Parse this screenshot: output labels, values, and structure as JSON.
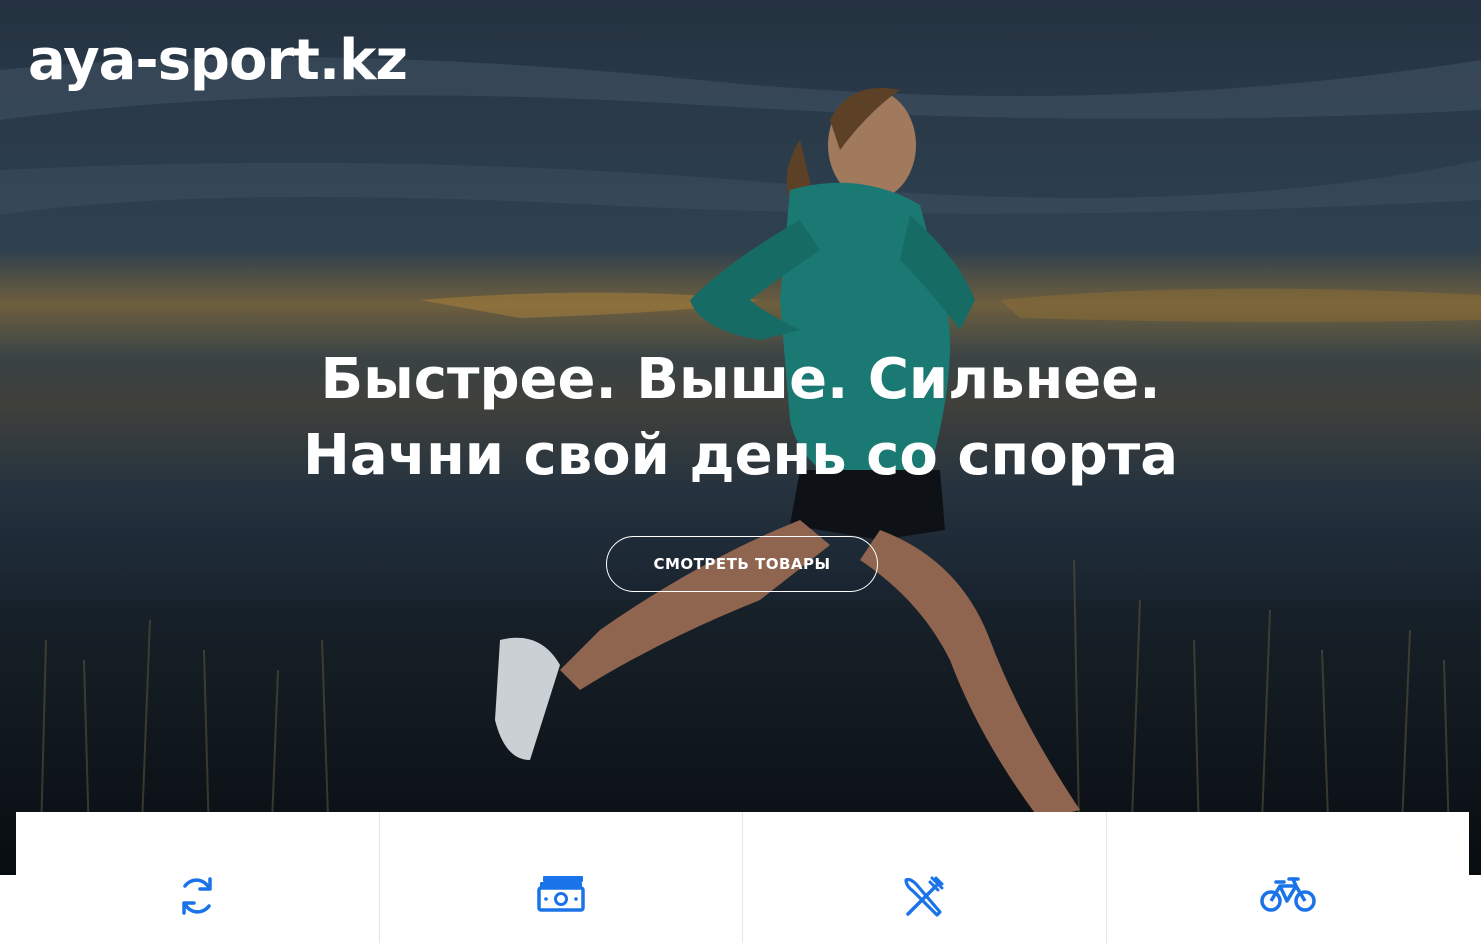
{
  "brand": {
    "name": "aya-sport.kz"
  },
  "hero": {
    "headline_line1": "Быстрее. Выше. Сильнее.",
    "headline_line2": "Начни свой день со спорта",
    "cta_label": "СМОТРЕТЬ ТОВАРЫ",
    "background": "running-woman-dusk-photo"
  },
  "features": [
    {
      "icon": "refresh-icon"
    },
    {
      "icon": "money-icon"
    },
    {
      "icon": "fork-knife-icon"
    },
    {
      "icon": "bicycle-icon"
    }
  ],
  "colors": {
    "accent": "#1a73e8",
    "text_on_hero": "#ffffff"
  }
}
